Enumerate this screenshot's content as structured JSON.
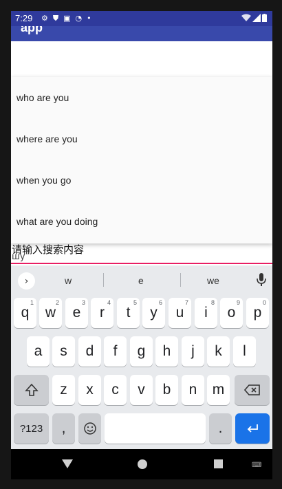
{
  "status_bar": {
    "time": "7:29",
    "icons": [
      "gear-icon",
      "shield-icon",
      "a-badge-icon",
      "wifi-question-icon",
      "dot-icon"
    ],
    "right_icons": [
      "wifi-icon",
      "signal-icon",
      "battery-icon"
    ]
  },
  "app_bar": {
    "title": "app"
  },
  "suggestions": [
    "who are you",
    "where are you",
    "when you go",
    "what are you doing"
  ],
  "search": {
    "placeholder": "请输入搜索内容",
    "typed": "шy"
  },
  "keyboard": {
    "suggestions": [
      "w",
      "e",
      "we"
    ],
    "row1": [
      {
        "label": "q",
        "hint": "1"
      },
      {
        "label": "w",
        "hint": "2"
      },
      {
        "label": "e",
        "hint": "3"
      },
      {
        "label": "r",
        "hint": "4"
      },
      {
        "label": "t",
        "hint": "5"
      },
      {
        "label": "y",
        "hint": "6"
      },
      {
        "label": "u",
        "hint": "7"
      },
      {
        "label": "i",
        "hint": "8"
      },
      {
        "label": "o",
        "hint": "9"
      },
      {
        "label": "p",
        "hint": "0"
      }
    ],
    "row2": [
      "a",
      "s",
      "d",
      "f",
      "g",
      "h",
      "j",
      "k",
      "l"
    ],
    "row3": [
      "z",
      "x",
      "c",
      "v",
      "b",
      "n",
      "m"
    ],
    "symbols_label": "?123",
    "comma_label": ",",
    "period_label": "."
  },
  "colors": {
    "primary": "#3949ab",
    "status_bar": "#2f3a9c",
    "accent": "#e91e63",
    "enter_key": "#1a73e8"
  }
}
